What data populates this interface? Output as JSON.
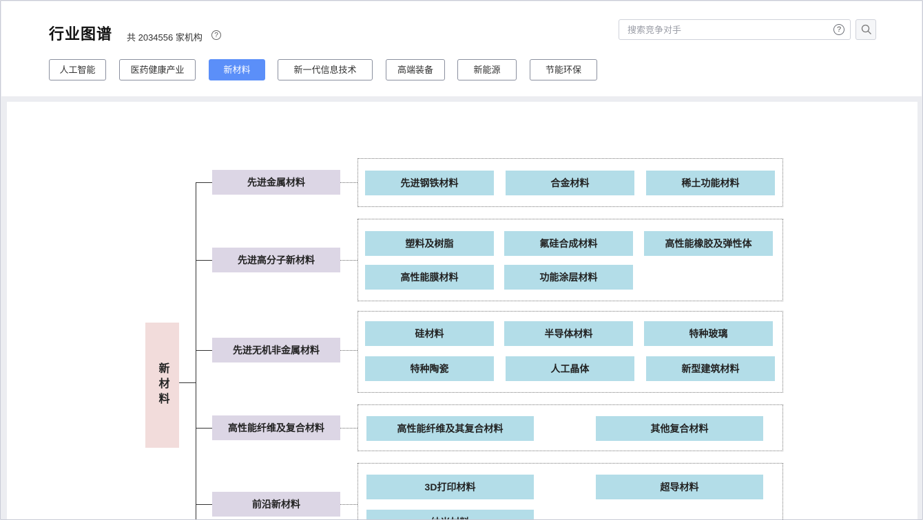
{
  "header": {
    "title": "行业图谱",
    "count_text": "共 2034556 家机构",
    "help_glyph": "?",
    "search_placeholder": "搜索竞争对手"
  },
  "tabs": [
    {
      "label": "人工智能",
      "active": false
    },
    {
      "label": "医药健康产业",
      "active": false
    },
    {
      "label": "新材料",
      "active": true
    },
    {
      "label": "新一代信息技术",
      "active": false
    },
    {
      "label": "高端装备",
      "active": false
    },
    {
      "label": "新能源",
      "active": false
    },
    {
      "label": "节能环保",
      "active": false
    }
  ],
  "tree": {
    "root": "新材料",
    "categories": [
      {
        "label": "先进金属材料",
        "items": [
          "先进钢铁材料",
          "合金材料",
          "稀土功能材料"
        ]
      },
      {
        "label": "先进高分子新材料",
        "items": [
          "塑料及树脂",
          "氟硅合成材料",
          "高性能橡胶及弹性体",
          "高性能膜材料",
          "功能涂层材料"
        ]
      },
      {
        "label": "先进无机非金属材料",
        "items": [
          "硅材料",
          "半导体材料",
          "特种玻璃",
          "特种陶瓷",
          "人工晶体",
          "新型建筑材料"
        ]
      },
      {
        "label": "高性能纤维及复合材料",
        "items": [
          "高性能纤维及其复合材料",
          "其他复合材料"
        ]
      },
      {
        "label": "前沿新材料",
        "items": [
          "3D打印材料",
          "超导材料",
          "纳米材料"
        ]
      }
    ]
  },
  "colors": {
    "active_tab": "#5b8ff9",
    "root_node": "#f2dcdb",
    "category_node": "#dcd6e5",
    "leaf_node": "#b3dde8"
  }
}
